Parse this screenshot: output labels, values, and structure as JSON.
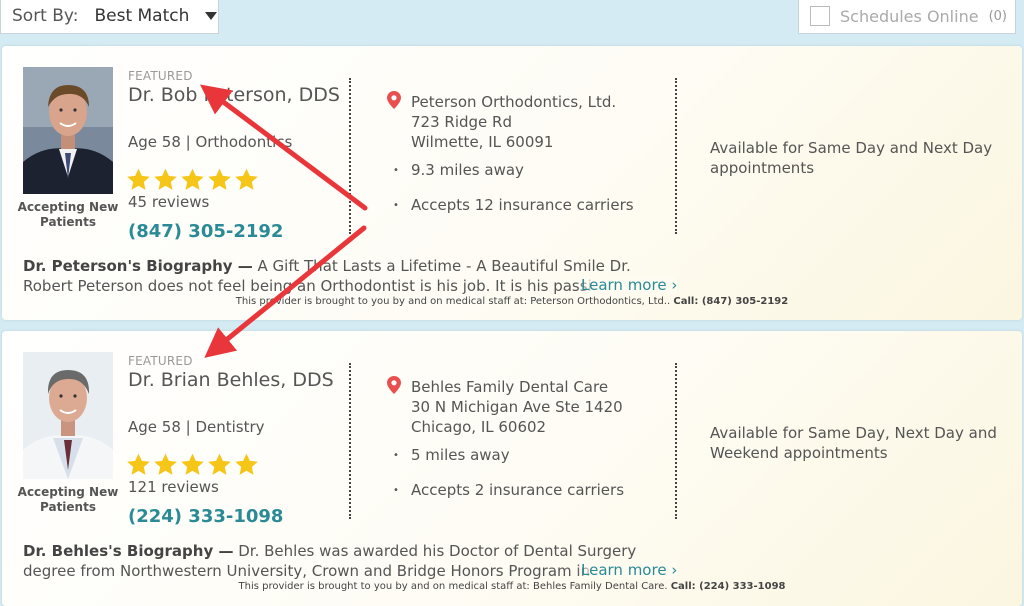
{
  "sort": {
    "label": "Sort By:",
    "value": "Best Match"
  },
  "schedules": {
    "label": "Schedules Online",
    "count": "(0)"
  },
  "providers": [
    {
      "featured": "FEATURED",
      "name": "Dr. Bob Peterson, DDS",
      "age_specialty": "Age 58  |  Orthodontics",
      "reviews": "45 reviews",
      "phone": "(847) 305-2192",
      "accepting": "Accepting New Patients",
      "practice": "Peterson Orthodontics, Ltd.",
      "street": "723 Ridge Rd",
      "city": "Wilmette, IL 60091",
      "distance": "9.3 miles away",
      "insurance": "Accepts 12 insurance carriers",
      "availability": "Available for Same Day and Next Day appointments",
      "bio_title": "Dr. Peterson's Biography —",
      "bio_text": "A Gift That Lasts a Lifetime - A Beautiful Smile Dr. Robert Peterson does not feel being an Orthodontist is his job. It is his passion and",
      "learn_more": "Learn more ›",
      "provider_note": "This provider is brought to you by and on medical staff at: Peterson Orthodontics, Ltd..",
      "provider_call": "Call: (847) 305-2192",
      "rating": 5
    },
    {
      "featured": "FEATURED",
      "name": "Dr. Brian Behles, DDS",
      "age_specialty": "Age 58  |  Dentistry",
      "reviews": "121 reviews",
      "phone": "(224) 333-1098",
      "accepting": "Accepting New Patients",
      "practice": "Behles Family Dental Care",
      "street": "30 N Michigan Ave Ste 1420",
      "city": "Chicago, IL 60602",
      "distance": "5 miles away",
      "insurance": "Accepts 2 insurance carriers",
      "availability": "Available for Same Day, Next Day and Weekend appointments",
      "bio_title": "Dr. Behles's Biography —",
      "bio_text": "Dr. Behles was awarded his Doctor of Dental Surgery degree from Northwestern University, Crown and Bridge Honors Program in 1985.",
      "learn_more": "Learn more ›",
      "provider_note": "This provider is brought to you by and on medical staff at: Behles Family Dental Care.",
      "provider_call": "Call: (224) 333-1098",
      "rating": 5
    }
  ],
  "colors": {
    "accent": "#2a8a96",
    "star": "#f5c518",
    "arrow": "#e8363b",
    "pin": "#e8504f"
  },
  "icons": {
    "sort_caret": "caret-down-icon",
    "pin": "map-pin-icon",
    "star": "star-icon",
    "checkbox": "checkbox-icon"
  }
}
